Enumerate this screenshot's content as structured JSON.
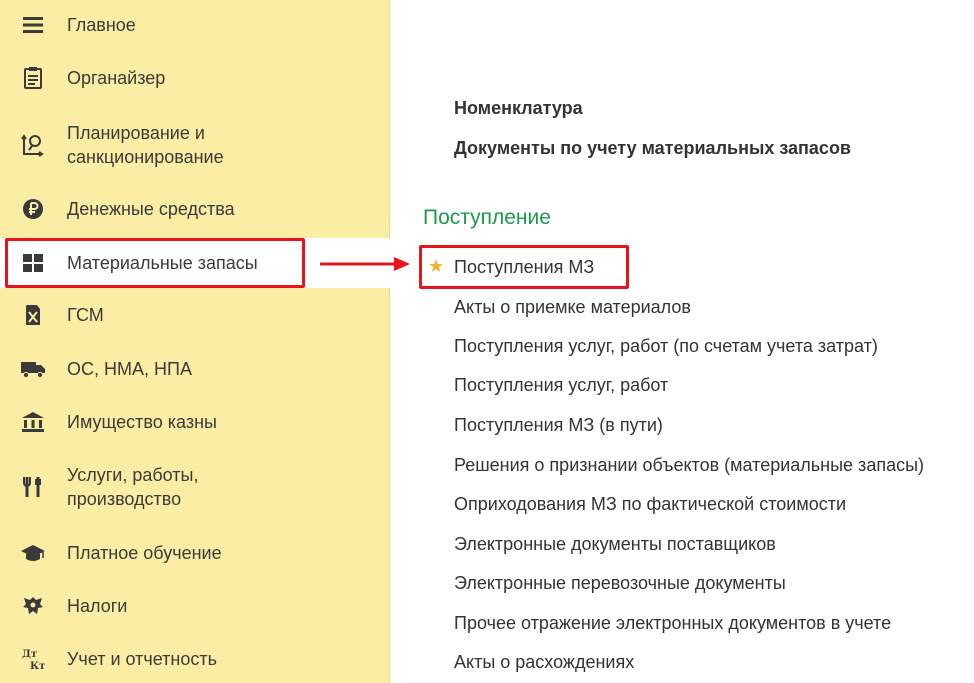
{
  "sidebar": {
    "items": [
      {
        "id": "main",
        "label": "Главное",
        "icon": "menu-icon"
      },
      {
        "id": "organizer",
        "label": "Органайзер",
        "icon": "clipboard-icon"
      },
      {
        "id": "planning",
        "label": "Планирование и\nсанкционирование",
        "icon": "planning-icon"
      },
      {
        "id": "money",
        "label": "Денежные средства",
        "icon": "ruble-coin-icon"
      },
      {
        "id": "materials",
        "label": "Материальные запасы",
        "icon": "grid-icon",
        "active": true
      },
      {
        "id": "fuel",
        "label": "ГСМ",
        "icon": "fuel-can-icon"
      },
      {
        "id": "assets",
        "label": "ОС, НМА, НПА",
        "icon": "truck-icon"
      },
      {
        "id": "treasury",
        "label": "Имущество казны",
        "icon": "bank-icon"
      },
      {
        "id": "services",
        "label": "Услуги, работы,\nпроизводство",
        "icon": "tools-icon"
      },
      {
        "id": "education",
        "label": "Платное обучение",
        "icon": "graduation-cap-icon"
      },
      {
        "id": "taxes",
        "label": "Налоги",
        "icon": "emblem-icon"
      },
      {
        "id": "reporting",
        "label": "Учет и отчетность",
        "icon": "debit-credit-icon"
      }
    ]
  },
  "content": {
    "top_links": [
      "Номенклатура",
      "Документы по учету материальных запасов"
    ],
    "section_title": "Поступление",
    "links": [
      "Поступления МЗ",
      "Акты о приемке материалов",
      "Поступления услуг, работ (по счетам учета затрат)",
      "Поступления услуг, работ",
      "Поступления МЗ (в пути)",
      "Решения о признании объектов (материальные запасы)",
      "Оприходования МЗ по фактической стоимости",
      "Электронные документы поставщиков",
      "Электронные перевозочные документы",
      "Прочее отражение электронных документов в учете",
      "Акты о расхождениях"
    ]
  },
  "colors": {
    "sidebar_bg": "#fbeda4",
    "section_title": "#1a9b4b",
    "highlight": "#e8141c",
    "star": "#f0b429"
  }
}
